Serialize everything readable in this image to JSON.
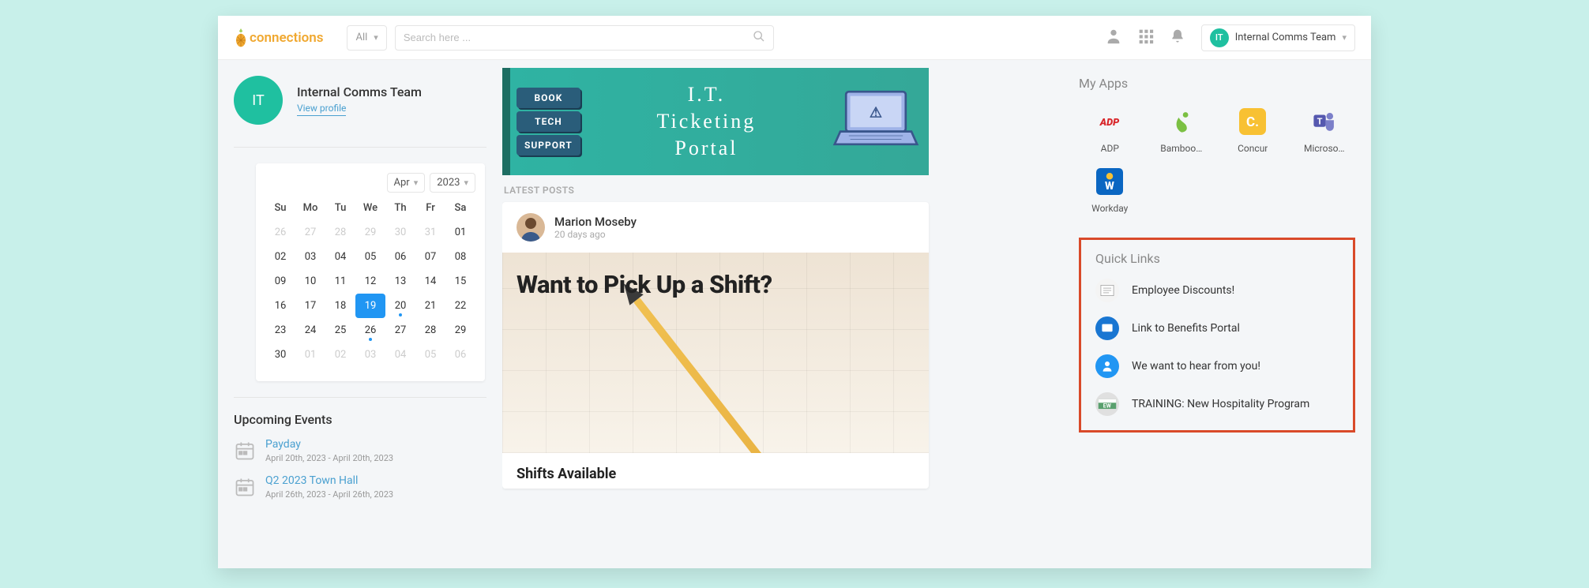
{
  "header": {
    "logo_text": "connections",
    "filter_selected": "All",
    "search_placeholder": "Search here ...",
    "user_name": "Internal Comms Team",
    "user_initials": "IT"
  },
  "profile": {
    "initials": "IT",
    "name": "Internal Comms Team",
    "view_profile": "View profile"
  },
  "calendar": {
    "month_selected": "Apr",
    "year_selected": "2023",
    "dow": [
      "Su",
      "Mo",
      "Tu",
      "We",
      "Th",
      "Fr",
      "Sa"
    ],
    "days": [
      {
        "n": "26",
        "muted": true
      },
      {
        "n": "27",
        "muted": true
      },
      {
        "n": "28",
        "muted": true
      },
      {
        "n": "29",
        "muted": true
      },
      {
        "n": "30",
        "muted": true
      },
      {
        "n": "31",
        "muted": true
      },
      {
        "n": "01"
      },
      {
        "n": "02"
      },
      {
        "n": "03"
      },
      {
        "n": "04"
      },
      {
        "n": "05"
      },
      {
        "n": "06"
      },
      {
        "n": "07"
      },
      {
        "n": "08"
      },
      {
        "n": "09"
      },
      {
        "n": "10"
      },
      {
        "n": "11"
      },
      {
        "n": "12"
      },
      {
        "n": "13"
      },
      {
        "n": "14"
      },
      {
        "n": "15"
      },
      {
        "n": "16"
      },
      {
        "n": "17"
      },
      {
        "n": "18"
      },
      {
        "n": "19",
        "active": true
      },
      {
        "n": "20",
        "dot": true
      },
      {
        "n": "21"
      },
      {
        "n": "22"
      },
      {
        "n": "23"
      },
      {
        "n": "24"
      },
      {
        "n": "25"
      },
      {
        "n": "26",
        "dot": true
      },
      {
        "n": "27"
      },
      {
        "n": "28"
      },
      {
        "n": "29"
      },
      {
        "n": "30"
      },
      {
        "n": "01",
        "muted": true
      },
      {
        "n": "02",
        "muted": true
      },
      {
        "n": "03",
        "muted": true
      },
      {
        "n": "04",
        "muted": true
      },
      {
        "n": "05",
        "muted": true
      },
      {
        "n": "06",
        "muted": true
      }
    ]
  },
  "upcoming": {
    "title": "Upcoming Events",
    "events": [
      {
        "title": "Payday",
        "date": "April 20th, 2023 - April 20th, 2023"
      },
      {
        "title": "Q2 2023 Town Hall",
        "date": "April 26th, 2023 - April 26th, 2023"
      }
    ]
  },
  "banner": {
    "blocks": [
      "BOOK",
      "TECH",
      "SUPPORT"
    ],
    "line1": "I.T.",
    "line2": "Ticketing",
    "line3": "Portal"
  },
  "feed": {
    "latest_label": "LATEST POSTS",
    "post": {
      "author": "Marion Moseby",
      "time": "20 days ago",
      "image_text": "Want to Pick Up a Shift?",
      "title": "Shifts Available"
    }
  },
  "apps": {
    "title": "My Apps",
    "items": [
      {
        "label": "ADP",
        "icon": "adp",
        "bg": "#fff",
        "fg": "#d8262a"
      },
      {
        "label": "Bamboo…",
        "icon": "bamboo",
        "bg": "#fff",
        "fg": "#7bc043"
      },
      {
        "label": "Concur",
        "icon": "concur",
        "bg": "#f8c133",
        "fg": "#fff"
      },
      {
        "label": "Microso…",
        "icon": "teams",
        "bg": "#fff",
        "fg": "#5558af"
      },
      {
        "label": "Workday",
        "icon": "workday",
        "bg": "#0a66c2",
        "fg": "#fff"
      }
    ]
  },
  "quicklinks": {
    "title": "Quick Links",
    "items": [
      {
        "label": "Employee Discounts!",
        "bg": "#f4f4f4"
      },
      {
        "label": "Link to Benefits Portal",
        "bg": "#1976d2"
      },
      {
        "label": "We want to hear from you!",
        "bg": "#2196f3"
      },
      {
        "label": "TRAINING: New Hospitality Program",
        "bg": "#e0e0e0"
      }
    ]
  }
}
